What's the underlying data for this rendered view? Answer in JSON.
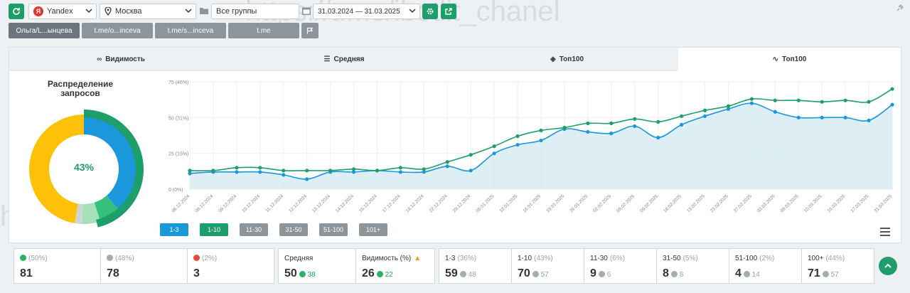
{
  "toolbar": {
    "engine": "Yandex",
    "region": "Москва",
    "group": "Все группы",
    "date_range": "31.03.2024 — 31.03.2025",
    "tags": [
      "Ольга/L...ынцева",
      "t.me/o...inceva",
      "t.me/s...inceva",
      "t.me"
    ]
  },
  "tabs": [
    {
      "label": "Видимость",
      "icon": "binoculars-icon"
    },
    {
      "label": "Средняя",
      "icon": "list-icon"
    },
    {
      "label": "Топ100",
      "icon": "layers-icon"
    },
    {
      "label": "Топ100",
      "icon": "chart-line-icon"
    }
  ],
  "distribution": {
    "title": "Распределение запросов",
    "center_value": "43%",
    "segments": [
      {
        "name": "1-3",
        "value": 36,
        "color": "#1b97db"
      },
      {
        "name": "1-10",
        "value": 43,
        "color": "#1e9e6a"
      },
      {
        "name": "11-30",
        "value": 6,
        "color": "#34c07a"
      },
      {
        "name": "31-50",
        "value": 5,
        "color": "#a6e0b8"
      },
      {
        "name": "51-100",
        "value": 2,
        "color": "#cfd4d8"
      },
      {
        "name": "100+",
        "value": 44,
        "color": "#ffc107"
      }
    ]
  },
  "chart_data": {
    "type": "line",
    "y_ticks": [
      "75 (46%)",
      "50 (31%)",
      "25 (15%)",
      "0 (0%)"
    ],
    "ylim": [
      0,
      75
    ],
    "x": [
      "06.12.2024",
      "08.12.2024",
      "09.12.2024",
      "10.12.2024",
      "11.12.2024",
      "12.12.2024",
      "13.12.2024",
      "14.12.2024",
      "15.12.2024",
      "17.12.2024",
      "18.12.2024",
      "22.12.2024",
      "29.12.2024",
      "05.01.2025",
      "12.01.2025",
      "16.01.2025",
      "19.01.2025",
      "26.01.2025",
      "02.02.2025",
      "05.02.2025",
      "09.02.2025",
      "16.02.2025",
      "19.02.2025",
      "23.02.2025",
      "27.02.2025",
      "03.03.2025",
      "09.03.2025",
      "10.03.2025",
      "16.03.2025",
      "17.03.2025",
      "31.03.2025"
    ],
    "series": [
      {
        "name": "1-3",
        "color": "#1b97db",
        "values": [
          11,
          12,
          12,
          12,
          10,
          7,
          12,
          12,
          13,
          12,
          12,
          16,
          13,
          25,
          31,
          34,
          42,
          40,
          39,
          44,
          36,
          45,
          51,
          56,
          60,
          54,
          50,
          50,
          50,
          48,
          59
        ]
      },
      {
        "name": "1-10",
        "color": "#1e9e6a",
        "values": [
          13,
          13,
          15,
          15,
          13,
          13,
          13,
          14,
          13,
          15,
          14,
          19,
          24,
          30,
          37,
          41,
          43,
          46,
          46,
          49,
          47,
          51,
          55,
          58,
          63,
          62,
          62,
          61,
          62,
          61,
          70
        ]
      }
    ],
    "legend_items": [
      "1-3",
      "1-10",
      "11-30",
      "31-50",
      "51-100",
      "101+"
    ],
    "legend_colors": [
      "#1b97db",
      "#1e9e6a",
      "#8c949c",
      "#8c949c",
      "#8c949c",
      "#8c949c"
    ]
  },
  "stats": {
    "up": {
      "pct": "(50%)",
      "value": "81"
    },
    "flat": {
      "pct": "(48%)",
      "value": "78"
    },
    "down": {
      "pct": "(2%)",
      "value": "3"
    },
    "avg": {
      "label": "Средняя",
      "value": "50",
      "delta": "38"
    },
    "visibility": {
      "label": "Видимость (%)",
      "value": "26",
      "delta": "22"
    },
    "ranges": [
      {
        "label": "1-3",
        "pct": "(36%)",
        "value": "59",
        "prev": "48"
      },
      {
        "label": "1-10",
        "pct": "(43%)",
        "value": "70",
        "prev": "57"
      },
      {
        "label": "11-30",
        "pct": "(6%)",
        "value": "9",
        "prev": "6"
      },
      {
        "label": "31-50",
        "pct": "(5%)",
        "value": "8",
        "prev": "8"
      },
      {
        "label": "51-100",
        "pct": "(2%)",
        "value": "4",
        "prev": "14"
      },
      {
        "label": "100+",
        "pct": "(44%)",
        "value": "71",
        "prev": "57"
      }
    ]
  },
  "watermark": "https://t.me/ibotlit_chanel"
}
